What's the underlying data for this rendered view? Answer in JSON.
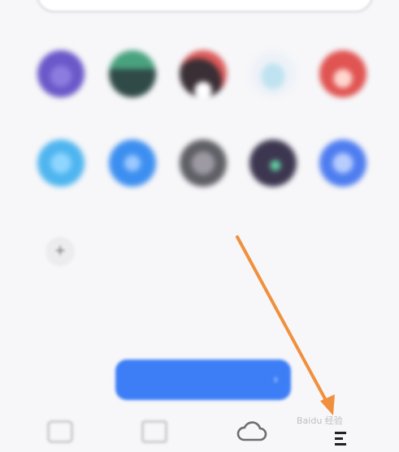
{
  "apps_row1": [
    {
      "label": "",
      "color": "#6b58c9",
      "inner": "#8d7ce0",
      "icon": "purple-app-icon"
    },
    {
      "label": "",
      "color": "#2f4a47",
      "inner": "#49a27e",
      "icon": "green-app-icon"
    },
    {
      "label": "",
      "color": "#3a2f35",
      "inner": "#e05a5a",
      "icon": "dark-app-icon"
    },
    {
      "label": "",
      "color": "#eef2f8",
      "inner": "#bfe3f0",
      "icon": "light-app-icon"
    },
    {
      "label": "",
      "color": "#e05452",
      "inner": "#ffd7cf",
      "icon": "red-app-icon"
    }
  ],
  "apps_row2": [
    {
      "label": "",
      "color": "#4fb5ef",
      "inner": "#8fd6ff",
      "icon": "blue-folder-app-icon"
    },
    {
      "label": "",
      "color": "#3c8ff0",
      "inner": "#9cc8ff",
      "icon": "blue-circle-app-icon"
    },
    {
      "label": "",
      "color": "#5f5f66",
      "inner": "#9e9aa3",
      "icon": "gray-app-icon"
    },
    {
      "label": "",
      "color": "#3d3650",
      "inner": "#5fd1a0",
      "icon": "dark-purple-app-icon"
    },
    {
      "label": "",
      "color": "#4e7df0",
      "inner": "#b7cdfd",
      "icon": "blue-app-icon"
    }
  ],
  "add_button": {
    "label": "+"
  },
  "banner": {
    "text": "",
    "chevron": "›"
  },
  "bottom_nav": [
    {
      "name": "nav-tab-1"
    },
    {
      "name": "nav-tab-2"
    },
    {
      "name": "nav-cloud"
    },
    {
      "name": "nav-menu"
    }
  ],
  "annotation": {
    "color": "#f0903e"
  },
  "watermark": {
    "text": "Baidu 经验"
  }
}
